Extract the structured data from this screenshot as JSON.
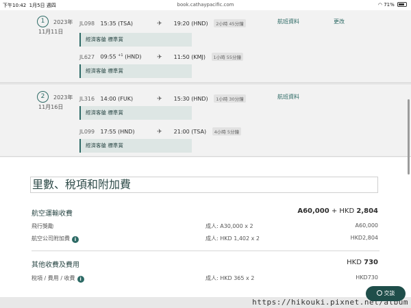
{
  "status_bar": {
    "time": "下午10:42",
    "date": "1月5日 週四",
    "url": "book.cathaypacific.com",
    "battery": "71%"
  },
  "legs": [
    {
      "number": "1",
      "year": "2023年",
      "date": "11月11日",
      "link_info": "航班資料",
      "link_change": "更改",
      "flights": [
        {
          "flight_no": "JL098",
          "dep_time": "15:35",
          "dep_code": "(TSA)",
          "dep_sup": "",
          "arr_time": "19:20",
          "arr_code": "(HND)",
          "duration": "2小時 45分鐘",
          "cabin": "經濟客艙 標準賞"
        },
        {
          "flight_no": "JL627",
          "dep_time": "09:55",
          "dep_code": "(HND)",
          "dep_sup": "+1",
          "arr_time": "11:50",
          "arr_code": "(KMJ)",
          "duration": "1小時 55分鐘",
          "cabin": "經濟客艙 標準賞"
        }
      ]
    },
    {
      "number": "2",
      "year": "2023年",
      "date": "11月16日",
      "link_info": "航班資料",
      "flights": [
        {
          "flight_no": "JL316",
          "dep_time": "14:00",
          "dep_code": "(FUK)",
          "dep_sup": "",
          "arr_time": "15:30",
          "arr_code": "(HND)",
          "duration": "1小時 30分鐘",
          "cabin": "經濟客艙 標準賞"
        },
        {
          "flight_no": "JL099",
          "dep_time": "17:55",
          "dep_code": "(HND)",
          "dep_sup": "",
          "arr_time": "21:00",
          "arr_code": "(TSA)",
          "duration": "4小時 5分鐘",
          "cabin": "經濟客艙 標準賞"
        }
      ]
    }
  ],
  "fare": {
    "title": "里數、稅項和附加費",
    "air_transport": {
      "label": "航空運輸收費",
      "total_miles": "A60,000",
      "total_plus": " + HKD ",
      "total_hkd": "2,804",
      "rows": [
        {
          "label": "飛行獎勵",
          "detail": "成人: A30,000 x 2",
          "amount": "A60,000"
        },
        {
          "label": "航空公司附加費",
          "detail": "成人: HKD 1,402 x 2",
          "amount": "HKD2,804"
        }
      ]
    },
    "other_fees": {
      "label": "其他收費及費用",
      "total_prefix": "HKD ",
      "total_amount": "730",
      "rows": [
        {
          "label": "稅項 / 費用 / 收費",
          "detail": "成人: HKD 365 x 2",
          "amount": "HKD730"
        }
      ]
    }
  },
  "chat_button": "交談",
  "watermark": "https://hikouki.pixnet.net/album"
}
